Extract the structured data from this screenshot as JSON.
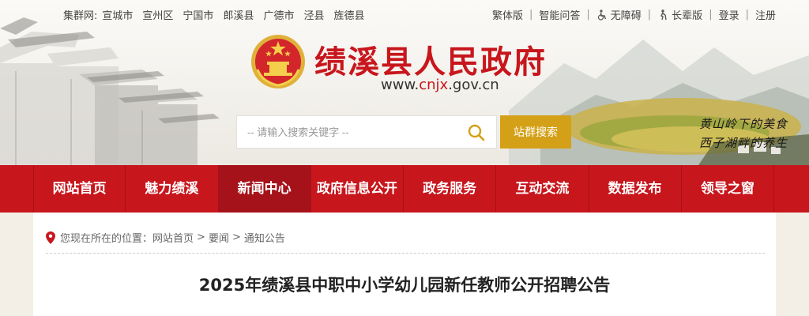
{
  "topbar": {
    "cluster_label": "集群网:",
    "cluster_sites": [
      "宣城市",
      "宣州区",
      "宁国市",
      "郎溪县",
      "广德市",
      "泾县",
      "旌德县"
    ],
    "traditional": "繁体版",
    "smart_qa": "智能问答",
    "accessibility": "无障碍",
    "elderly": "长辈版",
    "login": "登录",
    "register": "注册",
    "separator": "|"
  },
  "header": {
    "site_title": "绩溪县人民政府",
    "url_prefix": "www.",
    "url_highlight": "cnjx",
    "url_suffix": ".gov.cn",
    "slogan_line1": "黄山岭下的美食",
    "slogan_line2": "西子湖畔的养生"
  },
  "search": {
    "placeholder": "-- 请输入搜索关键字 --",
    "button_label": "站群搜索"
  },
  "nav": {
    "items": [
      "网站首页",
      "魅力绩溪",
      "新闻中心",
      "政府信息公开",
      "政务服务",
      "互动交流",
      "数据发布",
      "领导之窗"
    ],
    "active_index": 2
  },
  "breadcrumb": {
    "prefix": "您现在所在的位置：",
    "items": [
      "网站首页",
      "要闻",
      "通知公告"
    ],
    "separator": ">"
  },
  "article": {
    "title": "2025年绩溪县中职中小学幼儿园新任教师公开招聘公告"
  },
  "colors": {
    "brand_red": "#c8161d",
    "nav_active": "#a6121a",
    "search_button": "#d4a017",
    "page_background": "#f4efe6"
  }
}
